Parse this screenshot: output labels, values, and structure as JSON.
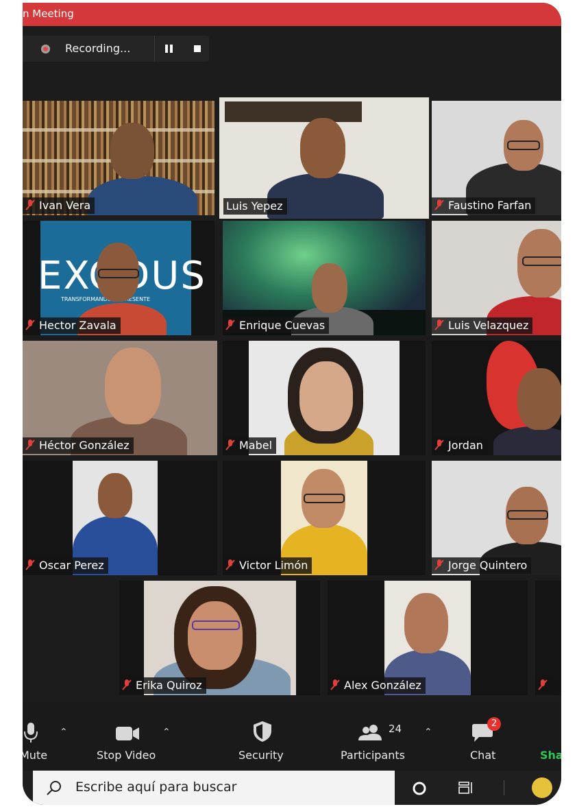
{
  "window": {
    "title": "n Meeting"
  },
  "recording": {
    "label": "Recording..."
  },
  "participants": [
    {
      "name": "Ivan Vera",
      "muted": true
    },
    {
      "name": "Luis Yepez",
      "muted": false,
      "active_speaker": true
    },
    {
      "name": "Faustino Farfan",
      "muted": true
    },
    {
      "name": "Hector Zavala",
      "muted": true,
      "background_text": "EXODUS",
      "background_subtext": "TRANSFORMANDO EL PRESENTE"
    },
    {
      "name": "Enrique Cuevas",
      "muted": true
    },
    {
      "name": "Luis Velazquez",
      "muted": true
    },
    {
      "name": "Héctor González",
      "muted": true
    },
    {
      "name": "Mabel",
      "muted": true
    },
    {
      "name": "Jordan",
      "muted": true
    },
    {
      "name": "Oscar Perez",
      "muted": true
    },
    {
      "name": "Victor Limón",
      "muted": true
    },
    {
      "name": "Jorge Quintero",
      "muted": true
    },
    {
      "name": "Erika Quiroz",
      "muted": true
    },
    {
      "name": "Alex González",
      "muted": true
    }
  ],
  "toolbar": {
    "mute": "Mute",
    "stop_video": "Stop Video",
    "security": "Security",
    "participants": "Participants",
    "participants_count": "24",
    "chat": "Chat",
    "chat_badge": "2",
    "share": "Sha"
  },
  "taskbar": {
    "search_placeholder": "Escribe aquí para buscar"
  },
  "colors": {
    "title_bar": "#d4383a",
    "active_speaker_border": "#cfe05a",
    "muted_icon": "#e0403a",
    "share_text": "#2dc653"
  }
}
